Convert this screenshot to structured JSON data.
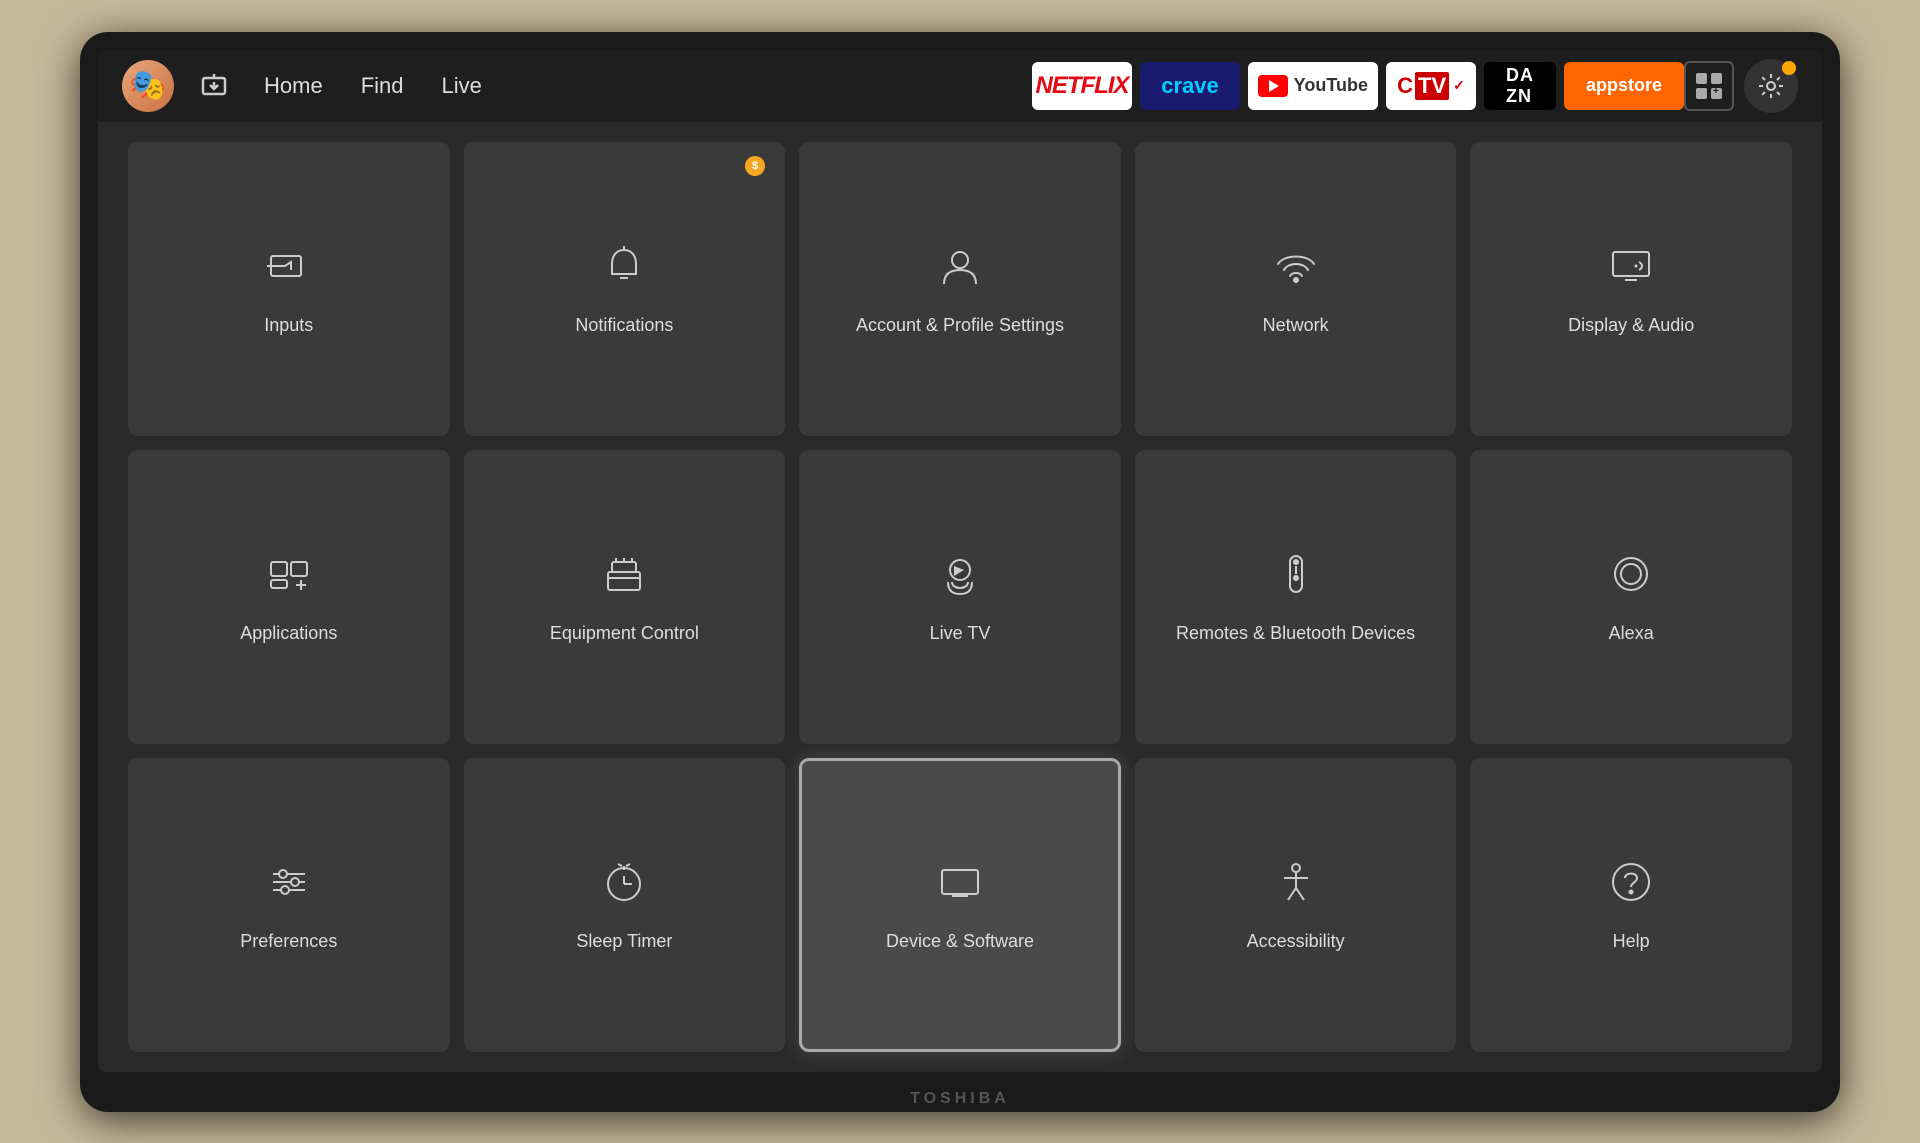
{
  "tv": {
    "brand": "TOSHIBA"
  },
  "nav": {
    "home_label": "Home",
    "find_label": "Find",
    "live_label": "Live",
    "apps": [
      {
        "name": "Netflix",
        "type": "netflix"
      },
      {
        "name": "Crave",
        "type": "crave"
      },
      {
        "name": "YouTube",
        "type": "youtube"
      },
      {
        "name": "CTV",
        "type": "ctv"
      },
      {
        "name": "DAZN",
        "type": "dazn"
      },
      {
        "name": "appstore",
        "type": "appstore"
      }
    ]
  },
  "settings": {
    "tiles": [
      {
        "id": "inputs",
        "label": "Inputs",
        "icon": "inputs"
      },
      {
        "id": "notifications",
        "label": "Notifications",
        "icon": "notifications",
        "badge": true
      },
      {
        "id": "account",
        "label": "Account & Profile Settings",
        "icon": "account"
      },
      {
        "id": "network",
        "label": "Network",
        "icon": "network"
      },
      {
        "id": "display-audio",
        "label": "Display & Audio",
        "icon": "display-audio"
      },
      {
        "id": "applications",
        "label": "Applications",
        "icon": "applications"
      },
      {
        "id": "equipment-control",
        "label": "Equipment Control",
        "icon": "equipment-control"
      },
      {
        "id": "live-tv",
        "label": "Live TV",
        "icon": "live-tv"
      },
      {
        "id": "remotes-bluetooth",
        "label": "Remotes & Bluetooth Devices",
        "icon": "remotes-bluetooth"
      },
      {
        "id": "alexa",
        "label": "Alexa",
        "icon": "alexa"
      },
      {
        "id": "preferences",
        "label": "Preferences",
        "icon": "preferences"
      },
      {
        "id": "sleep-timer",
        "label": "Sleep Timer",
        "icon": "sleep-timer"
      },
      {
        "id": "device-software",
        "label": "Device & Software",
        "icon": "device-software",
        "focused": true
      },
      {
        "id": "accessibility",
        "label": "Accessibility",
        "icon": "accessibility"
      },
      {
        "id": "help",
        "label": "Help",
        "icon": "help"
      }
    ]
  }
}
